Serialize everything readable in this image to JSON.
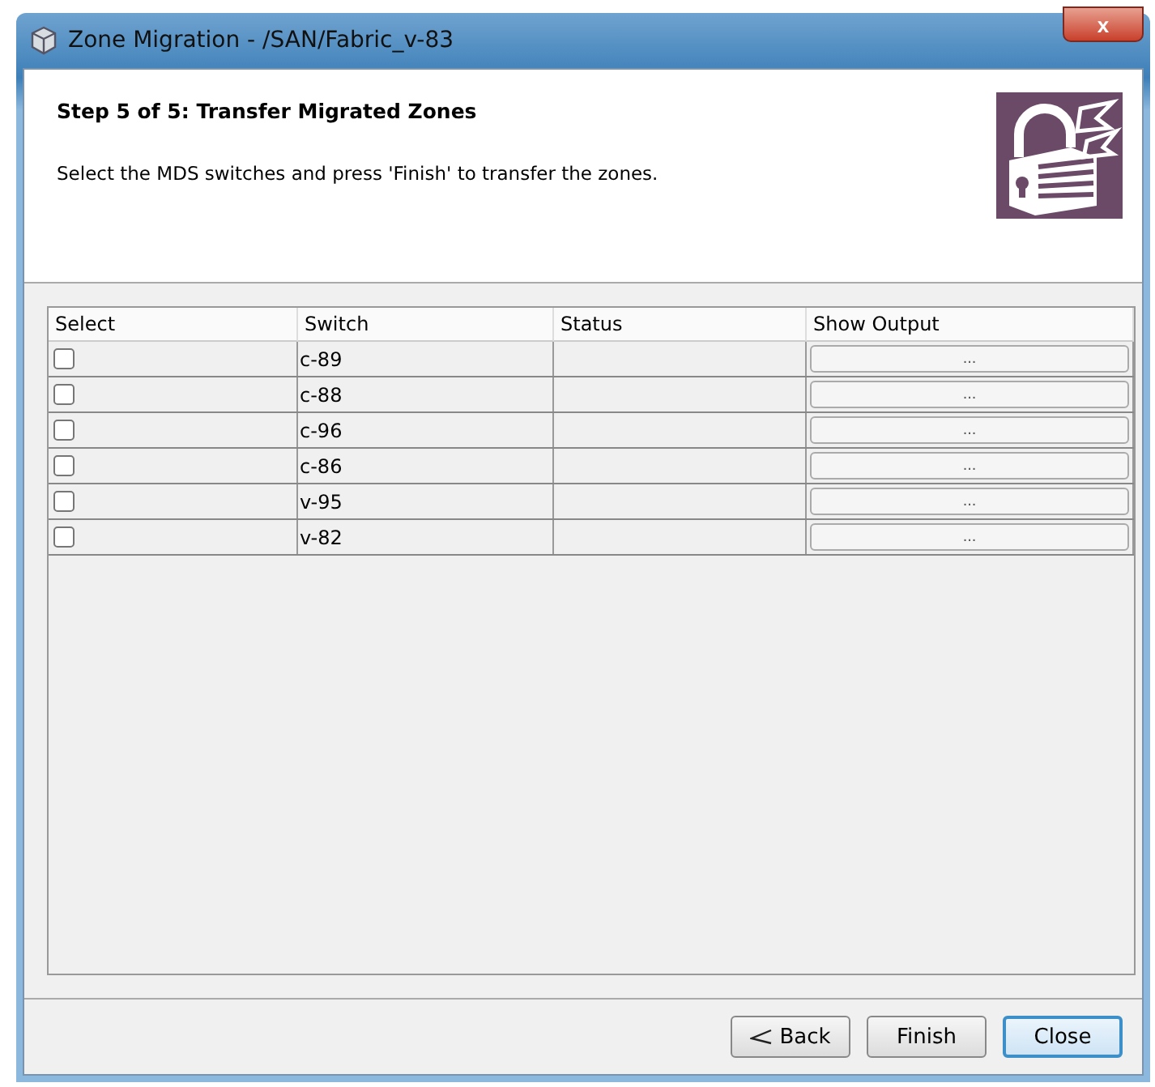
{
  "window": {
    "title": "Zone Migration - /SAN/Fabric_v-83",
    "close": "x"
  },
  "header": {
    "step": "Step 5 of 5: Transfer Migrated Zones",
    "instruction": "Select the MDS switches and press 'Finish' to transfer the zones."
  },
  "table": {
    "columns": [
      "Select",
      "Switch",
      "Status",
      "Show Output"
    ],
    "rows": [
      {
        "checked": false,
        "switch": "c-89",
        "output": "..."
      },
      {
        "checked": false,
        "switch": "c-88",
        "output": "..."
      },
      {
        "checked": false,
        "switch": "c-96",
        "output": "..."
      },
      {
        "checked": false,
        "switch": "c-86",
        "output": "..."
      },
      {
        "checked": false,
        "switch": "v-95",
        "output": "..."
      },
      {
        "checked": false,
        "switch": "v-82",
        "output": "..."
      }
    ]
  },
  "buttons": [
    {
      "kind": "back",
      "label": "Back",
      "focused": false
    },
    {
      "kind": "plain",
      "label": "Finish",
      "focused": false
    },
    {
      "kind": "plain",
      "label": "Close",
      "focused": true
    }
  ]
}
